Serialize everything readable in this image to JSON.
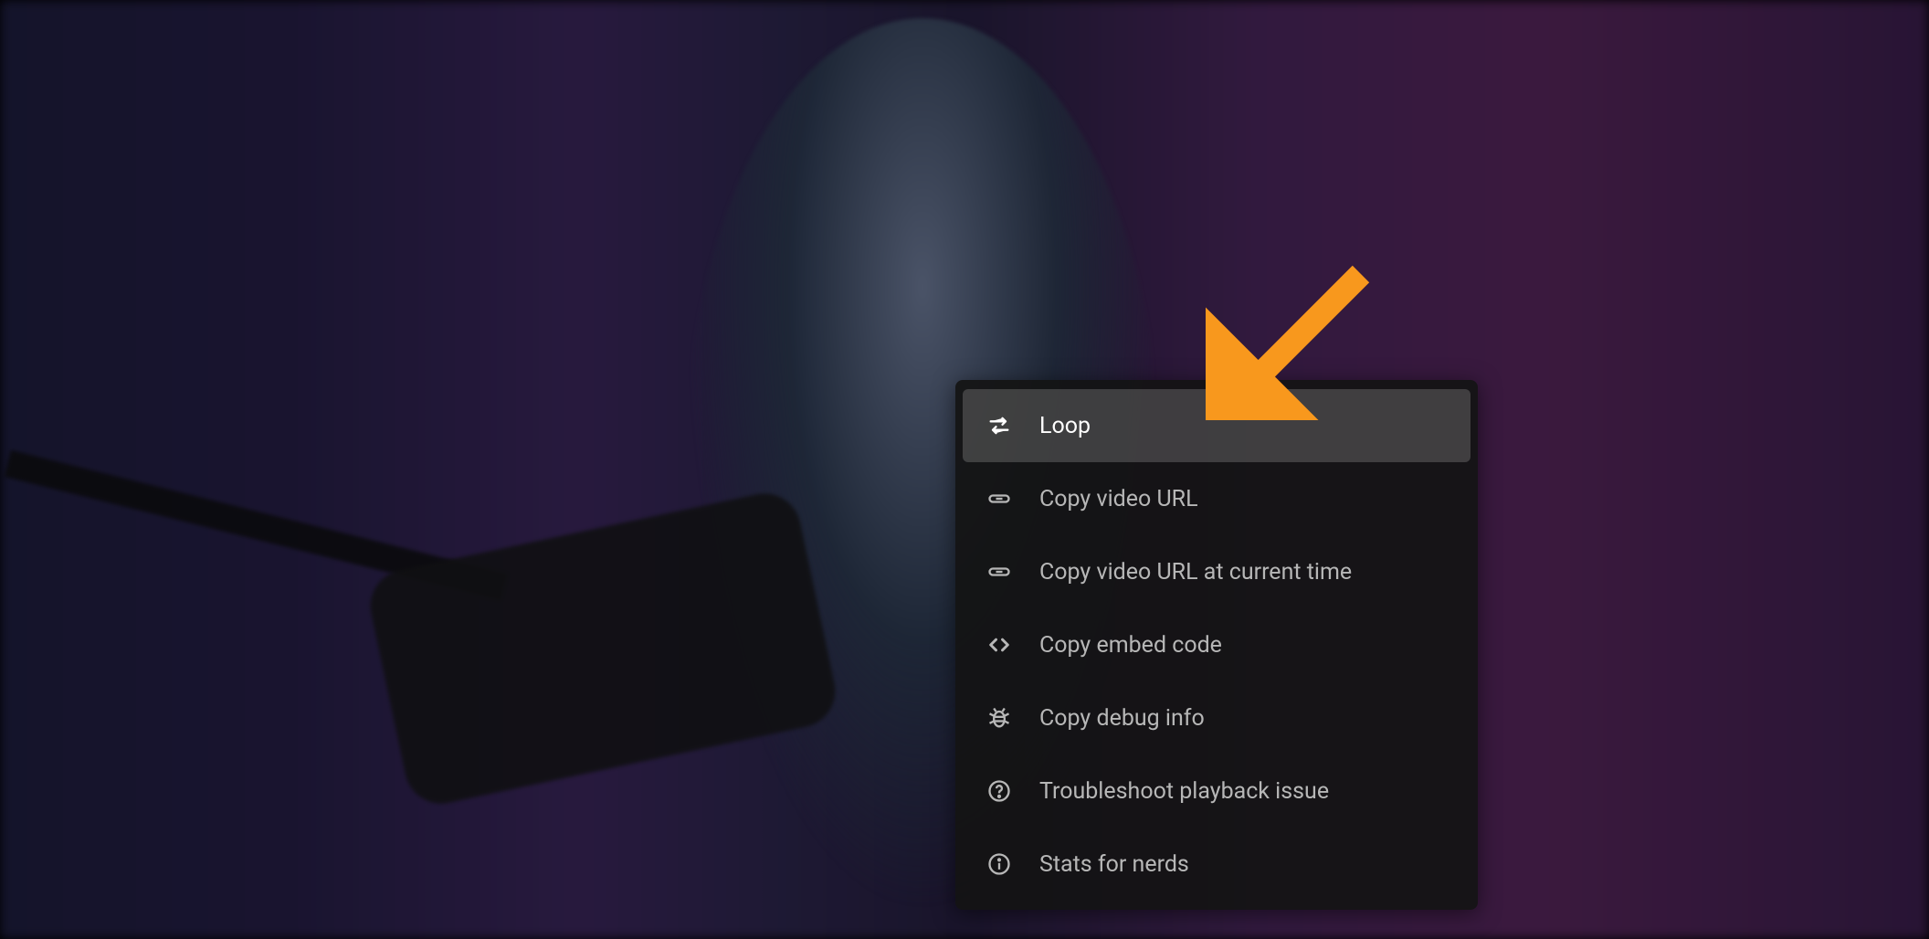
{
  "annotation": {
    "arrow_color": "#f8981d"
  },
  "context_menu": {
    "items": [
      {
        "icon": "loop-icon",
        "label": "Loop",
        "highlighted": true
      },
      {
        "icon": "link-icon",
        "label": "Copy video URL",
        "highlighted": false
      },
      {
        "icon": "link-icon",
        "label": "Copy video URL at current time",
        "highlighted": false
      },
      {
        "icon": "code-icon",
        "label": "Copy embed code",
        "highlighted": false
      },
      {
        "icon": "bug-icon",
        "label": "Copy debug info",
        "highlighted": false
      },
      {
        "icon": "help-icon",
        "label": "Troubleshoot playback issue",
        "highlighted": false
      },
      {
        "icon": "info-icon",
        "label": "Stats for nerds",
        "highlighted": false
      }
    ]
  }
}
